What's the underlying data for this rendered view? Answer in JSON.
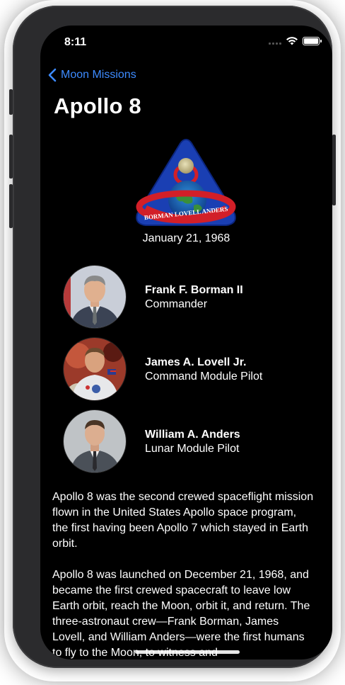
{
  "status_bar": {
    "time": "8:11"
  },
  "nav": {
    "back_label": "Moon Missions"
  },
  "mission": {
    "title": "Apollo 8",
    "patch_text": "BORMAN LOVELL ANDERS",
    "date": "January 21, 1968"
  },
  "crew": [
    {
      "name": "Frank F. Borman II",
      "role": "Commander"
    },
    {
      "name": "James A. Lovell Jr.",
      "role": "Command Module Pilot"
    },
    {
      "name": "William A. Anders",
      "role": "Lunar Module Pilot"
    }
  ],
  "description": {
    "paragraphs": [
      "Apollo 8 was the second crewed spaceflight mission flown in the United States Apollo space program, the first having been Apollo 7 which stayed in Earth orbit.",
      "Apollo 8 was launched on December 21, 1968, and became the first crewed spacecraft to leave low Earth orbit, reach the Moon, orbit it, and return. The three-astronaut crew—Frank Borman, James Lovell, and William Anders—were the first humans to fly to the Moon, to witness and"
    ]
  },
  "colors": {
    "accent": "#3d8bff",
    "background": "#000000",
    "text": "#ffffff"
  },
  "icons": {
    "back": "chevron-left-icon",
    "wifi": "wifi-icon",
    "battery": "battery-icon",
    "signal": "cellular-signal-icon"
  }
}
